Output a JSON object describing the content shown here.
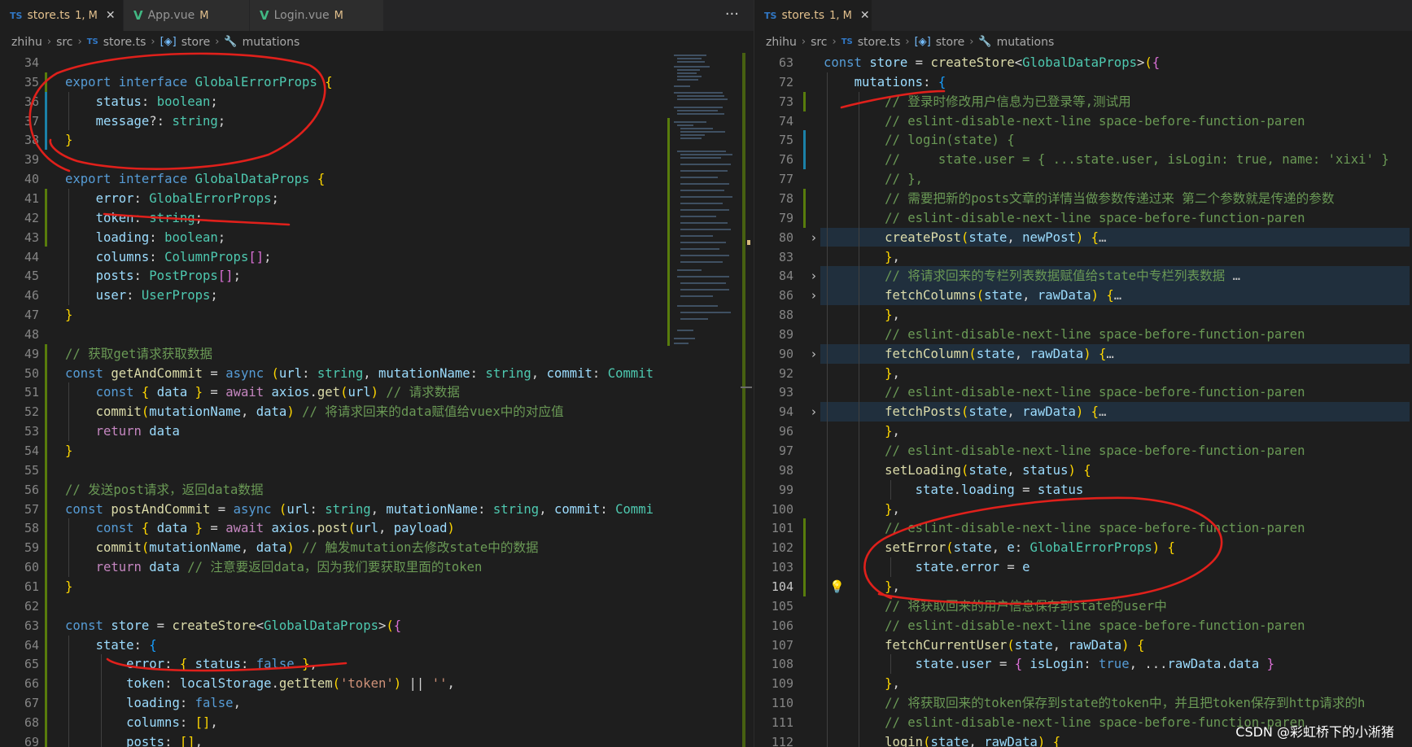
{
  "left_tabs": [
    {
      "icon": "TS",
      "label": "store.ts",
      "status": "1, M",
      "close": "✕",
      "active": true
    },
    {
      "icon": "V",
      "label": "App.vue",
      "status": "M",
      "active": false
    },
    {
      "icon": "V",
      "label": "Login.vue",
      "status": "M",
      "active": false
    }
  ],
  "tab_more": "···",
  "right_tabs": [
    {
      "icon": "TS",
      "label": "store.ts",
      "status": "1, M",
      "close": "✕",
      "active": true
    }
  ],
  "breadcrumb": {
    "root": "zhihu",
    "src": "src",
    "file_icon": "TS",
    "file": "store.ts",
    "symbol_store": "store",
    "symbol_mutations": "mutations"
  },
  "left_code": [
    {
      "n": "34",
      "h": ""
    },
    {
      "n": "35",
      "h": "<span class='k'>export</span> <span class='k'>interface</span> <span class='t'>GlobalErrorProps</span> <span class='b1'>{</span>"
    },
    {
      "n": "36",
      "h": "    <span class='v'>status</span>: <span class='t'>boolean</span>;"
    },
    {
      "n": "37",
      "h": "    <span class='v'>message</span>?: <span class='t'>string</span>;"
    },
    {
      "n": "38",
      "h": "<span class='b1'>}</span>"
    },
    {
      "n": "39",
      "h": ""
    },
    {
      "n": "40",
      "h": "<span class='k'>export</span> <span class='k'>interface</span> <span class='t'>GlobalDataProps</span> <span class='b1'>{</span>"
    },
    {
      "n": "41",
      "h": "    <span class='v'>error</span>: <span class='t'>GlobalErrorProps</span>;"
    },
    {
      "n": "42",
      "h": "    <span class='v'>token</span>: <span class='t'>string</span>;"
    },
    {
      "n": "43",
      "h": "    <span class='v'>loading</span>: <span class='t'>boolean</span>;"
    },
    {
      "n": "44",
      "h": "    <span class='v'>columns</span>: <span class='t'>ColumnProps</span><span class='b2'>[]</span>;"
    },
    {
      "n": "45",
      "h": "    <span class='v'>posts</span>: <span class='t'>PostProps</span><span class='b2'>[]</span>;"
    },
    {
      "n": "46",
      "h": "    <span class='v'>user</span>: <span class='t'>UserProps</span>;"
    },
    {
      "n": "47",
      "h": "<span class='b1'>}</span>"
    },
    {
      "n": "48",
      "h": ""
    },
    {
      "n": "49",
      "h": "<span class='cm'>// 获取get请求获取数据</span>"
    },
    {
      "n": "50",
      "h": "<span class='k'>const</span> <span class='f'>getAndCommit</span> = <span class='k'>async</span> <span class='b1'>(</span><span class='v'>url</span>: <span class='t'>string</span>, <span class='v'>mutationName</span>: <span class='t'>string</span>, <span class='v'>commit</span>: <span class='t'>Commit</span>"
    },
    {
      "n": "51",
      "h": "    <span class='k'>const</span> <span class='b1'>{</span> <span class='v'>data</span> <span class='b1'>}</span> = <span class='c2'>await</span> <span class='v'>axios</span>.<span class='f'>get</span><span class='b1'>(</span><span class='v'>url</span><span class='b1'>)</span> <span class='cm'>// 请求数据</span>"
    },
    {
      "n": "52",
      "h": "    <span class='f'>commit</span><span class='b1'>(</span><span class='v'>mutationName</span>, <span class='v'>data</span><span class='b1'>)</span> <span class='cm'>// 将请求回来的data赋值给vuex中的对应值</span>"
    },
    {
      "n": "53",
      "h": "    <span class='c2'>return</span> <span class='v'>data</span>"
    },
    {
      "n": "54",
      "h": "<span class='b1'>}</span>"
    },
    {
      "n": "55",
      "h": ""
    },
    {
      "n": "56",
      "h": "<span class='cm'>// 发送post请求，返回data数据</span>"
    },
    {
      "n": "57",
      "h": "<span class='k'>const</span> <span class='f'>postAndCommit</span> = <span class='k'>async</span> <span class='b1'>(</span><span class='v'>url</span>: <span class='t'>string</span>, <span class='v'>mutationName</span>: <span class='t'>string</span>, <span class='v'>commit</span>: <span class='t'>Commi</span>"
    },
    {
      "n": "58",
      "h": "    <span class='k'>const</span> <span class='b1'>{</span> <span class='v'>data</span> <span class='b1'>}</span> = <span class='c2'>await</span> <span class='v'>axios</span>.<span class='f'>post</span><span class='b1'>(</span><span class='v'>url</span>, <span class='v'>payload</span><span class='b1'>)</span>"
    },
    {
      "n": "59",
      "h": "    <span class='f'>commit</span><span class='b1'>(</span><span class='v'>mutationName</span>, <span class='v'>data</span><span class='b1'>)</span> <span class='cm'>// 触发mutation去修改state中的数据</span>"
    },
    {
      "n": "60",
      "h": "    <span class='c2'>return</span> <span class='v'>data</span> <span class='cm'>// 注意要返回data，因为我们要获取里面的token</span>"
    },
    {
      "n": "61",
      "h": "<span class='b1'>}</span>"
    },
    {
      "n": "62",
      "h": ""
    },
    {
      "n": "63",
      "h": "<span class='k'>const</span> <span class='v'>store</span> = <span class='f'>createStore</span>&lt;<span class='t'>GlobalDataProps</span>&gt;<span class='b1'>(</span><span class='b2'>{</span>"
    },
    {
      "n": "64",
      "h": "    <span class='v'>state</span>: <span class='b3'>{</span>"
    },
    {
      "n": "65",
      "h": "        <span class='v'>error</span>: <span class='b1'>{</span> <span class='v'>status</span>: <span class='k'>false</span> <span class='b1'>}</span>,"
    },
    {
      "n": "66",
      "h": "        <span class='v'>token</span>: <span class='v'>localStorage</span>.<span class='f'>getItem</span><span class='b1'>(</span><span class='s'>'token'</span><span class='b1'>)</span> || <span class='s'>''</span>,"
    },
    {
      "n": "67",
      "h": "        <span class='v'>loading</span>: <span class='k'>false</span>,"
    },
    {
      "n": "68",
      "h": "        <span class='v'>columns</span>: <span class='b1'>[]</span>,"
    },
    {
      "n": "69",
      "h": "        <span class='v'>posts</span>: <span class='b1'>[]</span>,"
    }
  ],
  "right_code": [
    {
      "n": "63",
      "h": "<span class='k'>const</span> <span class='v'>store</span> = <span class='f'>createStore</span>&lt;<span class='t'>GlobalDataProps</span>&gt;<span class='b1'>(</span><span class='b2'>{</span>"
    },
    {
      "n": "72",
      "h": "    <span class='v'>mutations</span>: <span class='b3'>{</span>"
    },
    {
      "n": "73",
      "h": "        <span class='cm'>// 登录时修改用户信息为已登录等,测试用</span>"
    },
    {
      "n": "74",
      "h": "        <span class='cm'>// eslint-disable-next-line space-before-function-paren</span>"
    },
    {
      "n": "75",
      "h": "        <span class='cm'>// login(state) {</span>"
    },
    {
      "n": "76",
      "h": "        <span class='cm'>//     state.user = { ...state.user, isLogin: true, name: 'xixi' }</span>"
    },
    {
      "n": "77",
      "h": "        <span class='cm'>// },</span>"
    },
    {
      "n": "78",
      "h": "        <span class='cm'>// 需要把新的posts文章的详情当做参数传递过来 第二个参数就是传递的参数</span>"
    },
    {
      "n": "79",
      "h": "        <span class='cm'>// eslint-disable-next-line space-before-function-paren</span>"
    },
    {
      "n": "80",
      "h": "        <span class='f'>createPost</span><span class='b1'>(</span><span class='v'>state</span>, <span class='v'>newPost</span><span class='b1'>)</span> <span class='b1'>{</span><span class='fold'>…</span>",
      "fold": true,
      "hl": true
    },
    {
      "n": "83",
      "h": "        <span class='b1'>}</span>,"
    },
    {
      "n": "84",
      "h": "        <span class='cm'>// 将请求回来的专栏列表数据赋值给state中专栏列表数据</span> <span class='fold'>…</span>",
      "fold": true,
      "hl": true
    },
    {
      "n": "86",
      "h": "        <span class='f'>fetchColumns</span><span class='b1'>(</span><span class='v'>state</span>, <span class='v'>rawData</span><span class='b1'>)</span> <span class='b1'>{</span><span class='fold'>…</span>",
      "fold": true,
      "hl": true
    },
    {
      "n": "88",
      "h": "        <span class='b1'>}</span>,"
    },
    {
      "n": "89",
      "h": "        <span class='cm'>// eslint-disable-next-line space-before-function-paren</span>"
    },
    {
      "n": "90",
      "h": "        <span class='f'>fetchColumn</span><span class='b1'>(</span><span class='v'>state</span>, <span class='v'>rawData</span><span class='b1'>)</span> <span class='b1'>{</span><span class='fold'>…</span>",
      "fold": true,
      "hl": true
    },
    {
      "n": "92",
      "h": "        <span class='b1'>}</span>,"
    },
    {
      "n": "93",
      "h": "        <span class='cm'>// eslint-disable-next-line space-before-function-paren</span>"
    },
    {
      "n": "94",
      "h": "        <span class='f'>fetchPosts</span><span class='b1'>(</span><span class='v'>state</span>, <span class='v'>rawData</span><span class='b1'>)</span> <span class='b1'>{</span><span class='fold'>…</span>",
      "fold": true,
      "hl": true
    },
    {
      "n": "96",
      "h": "        <span class='b1'>}</span>,"
    },
    {
      "n": "97",
      "h": "        <span class='cm'>// eslint-disable-next-line space-before-function-paren</span>"
    },
    {
      "n": "98",
      "h": "        <span class='f'>setLoading</span><span class='b1'>(</span><span class='v'>state</span>, <span class='v'>status</span><span class='b1'>)</span> <span class='b1'>{</span>"
    },
    {
      "n": "99",
      "h": "            <span class='v'>state</span>.<span class='v'>loading</span> = <span class='v'>status</span>"
    },
    {
      "n": "100",
      "h": "        <span class='b1'>}</span>,"
    },
    {
      "n": "101",
      "h": "        <span class='cm'>// eslint-disable-next-line space-before-function-paren</span>"
    },
    {
      "n": "102",
      "h": "        <span class='f'>setError</span><span class='b1'>(</span><span class='v'>state</span>, <span class='v'>e</span>: <span class='t'>GlobalErrorProps</span><span class='b1'>)</span> <span class='b1'>{</span>"
    },
    {
      "n": "103",
      "h": "            <span class='v'>state</span>.<span class='v'>error</span> = <span class='v'>e</span>"
    },
    {
      "n": "104",
      "h": "        <span class='b1'>}</span>,",
      "cur": true
    },
    {
      "n": "105",
      "h": "        <span class='cm'>// 将获取回来的用户信息保存到state的user中</span>"
    },
    {
      "n": "106",
      "h": "        <span class='cm'>// eslint-disable-next-line space-before-function-paren</span>"
    },
    {
      "n": "107",
      "h": "        <span class='f'>fetchCurrentUser</span><span class='b1'>(</span><span class='v'>state</span>, <span class='v'>rawData</span><span class='b1'>)</span> <span class='b1'>{</span>"
    },
    {
      "n": "108",
      "h": "            <span class='v'>state</span>.<span class='v'>user</span> = <span class='b2'>{</span> <span class='v'>isLogin</span>: <span class='k'>true</span>, ...<span class='v'>rawData</span>.<span class='v'>data</span> <span class='b2'>}</span>"
    },
    {
      "n": "109",
      "h": "        <span class='b1'>}</span>,"
    },
    {
      "n": "110",
      "h": "        <span class='cm'>// 将获取回来的token保存到state的token中，并且把token保存到http请求的h</span>"
    },
    {
      "n": "111",
      "h": "        <span class='cm'>// eslint-disable-next-line space-before-function-paren</span>"
    },
    {
      "n": "112",
      "h": "        <span class='f'>login</span><span class='b1'>(</span><span class='v'>state</span>, <span class='v'>rawData</span><span class='b1'>)</span> <span class='b1'>{</span>"
    }
  ],
  "watermark": "CSDN @彩虹桥下的小淅猪",
  "colors": {
    "accent_annotation": "#e0201b",
    "added_gutter": "#587c0c",
    "modified_gutter": "#1b81a8"
  }
}
